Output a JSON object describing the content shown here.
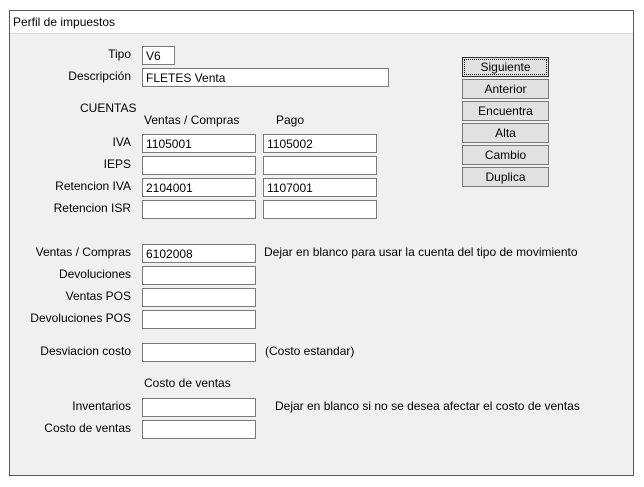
{
  "window": {
    "title": "Perfil de impuestos"
  },
  "tipo": {
    "label": "Tipo",
    "value": "V6"
  },
  "descripcion": {
    "label": "Descripción",
    "value": "FLETES Venta"
  },
  "cuentas": {
    "heading": "CUENTAS",
    "col_ventas": "Ventas / Compras",
    "col_pago": "Pago",
    "rows": [
      {
        "label": "IVA",
        "ventas": "1105001",
        "pago": "1105002"
      },
      {
        "label": "IEPS",
        "ventas": "",
        "pago": ""
      },
      {
        "label": "Retencion IVA",
        "ventas": "2104001",
        "pago": "1107001"
      },
      {
        "label": "Retencion ISR",
        "ventas": "",
        "pago": ""
      }
    ]
  },
  "movimientos": {
    "rows": [
      {
        "label": "Ventas / Compras",
        "value": "6102008"
      },
      {
        "label": "Devoluciones",
        "value": ""
      },
      {
        "label": "Ventas POS",
        "value": ""
      },
      {
        "label": "Devoluciones POS",
        "value": ""
      }
    ],
    "hint": "Dejar en blanco para usar la cuenta del tipo de movimiento"
  },
  "desviacion": {
    "label": "Desviacion costo",
    "value": "",
    "hint": "(Costo estandar)"
  },
  "costo_ventas": {
    "heading": "Costo de ventas",
    "rows": [
      {
        "label": "Inventarios",
        "value": ""
      },
      {
        "label": "Costo de ventas",
        "value": ""
      }
    ],
    "hint": "Dejar en blanco si no se desea afectar el costo de ventas"
  },
  "buttons": {
    "siguiente": "Siguiente",
    "anterior": "Anterior",
    "encuentra": "Encuentra",
    "alta": "Alta",
    "cambio": "Cambio",
    "duplica": "Duplica"
  }
}
